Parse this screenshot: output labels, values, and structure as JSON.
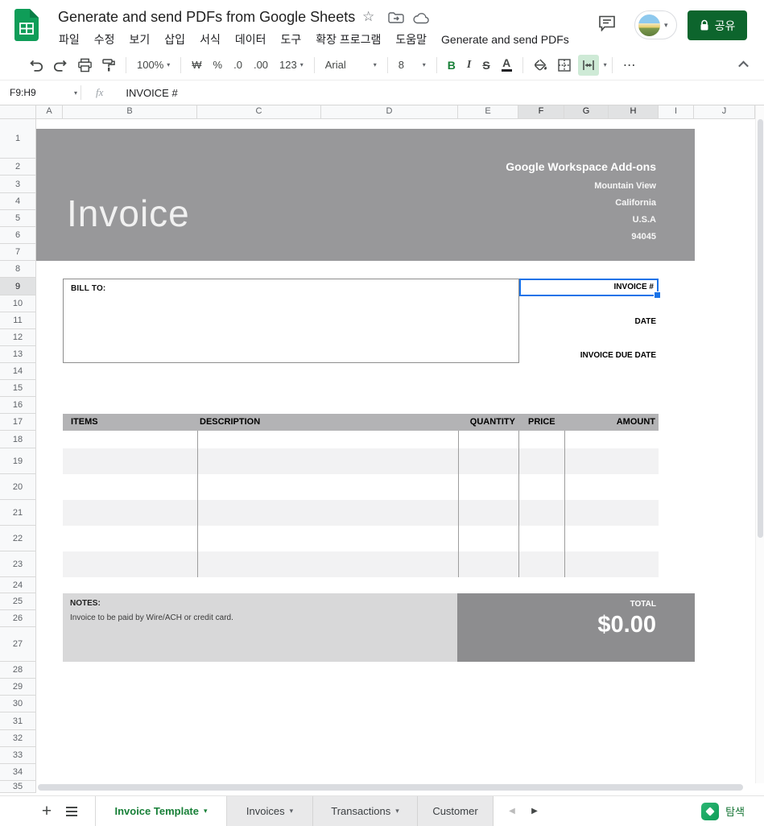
{
  "app": {
    "product": "Google Sheets",
    "doc_title": "Generate and send PDFs from Google Sheets",
    "menus": [
      "파일",
      "수정",
      "보기",
      "삽입",
      "서식",
      "데이터",
      "도구",
      "확장 프로그램",
      "도움말",
      "Generate and send PDFs"
    ],
    "share_label": "공유",
    "explore_label": "탐색"
  },
  "toolbar": {
    "zoom": "100%",
    "currency": "₩",
    "percent": "%",
    "decimal_decrease": ".0",
    "decimal_increase": ".00",
    "number_format": "123",
    "font_name": "Arial",
    "font_size": "8",
    "bold": "B",
    "italic": "I",
    "strikethrough": "S",
    "text_color": "A"
  },
  "formula_bar": {
    "cell_ref": "F9:H9",
    "fx_label": "fx",
    "value": "INVOICE #"
  },
  "grid": {
    "columns": [
      "A",
      "B",
      "C",
      "D",
      "E",
      "F",
      "G",
      "H",
      "I",
      "J"
    ],
    "rows": [
      "1",
      "2",
      "3",
      "4",
      "5",
      "6",
      "7",
      "8",
      "9",
      "10",
      "11",
      "12",
      "13",
      "14",
      "15",
      "16",
      "17",
      "18",
      "19",
      "20",
      "21",
      "22",
      "23",
      "24",
      "25",
      "26",
      "27",
      "28",
      "29",
      "30",
      "31",
      "32",
      "33",
      "34",
      "35"
    ],
    "selection": {
      "range": "F9:H9",
      "columns": [
        "F",
        "G",
        "H"
      ],
      "rows": [
        "9"
      ]
    }
  },
  "invoice": {
    "title": "Invoice",
    "company_name": "Google Workspace Add-ons",
    "address_lines": [
      "Mountain View",
      "California",
      "U.S.A",
      "94045"
    ],
    "bill_to_label": "BILL TO:",
    "invoice_number_label": "INVOICE #",
    "date_label": "DATE",
    "due_date_label": "INVOICE DUE DATE",
    "table_headers": [
      "ITEMS",
      "DESCRIPTION",
      "QUANTITY",
      "PRICE",
      "AMOUNT"
    ],
    "notes_label": "NOTES:",
    "notes_text": "Invoice to be paid by Wire/ACH or credit card.",
    "total_label": "TOTAL",
    "total_value": "$0.00"
  },
  "sheets_bar": {
    "tabs": [
      {
        "label": "Invoice Template",
        "active": true,
        "truncated": false
      },
      {
        "label": "Invoices",
        "active": false,
        "truncated": false
      },
      {
        "label": "Transactions",
        "active": false,
        "truncated": false
      },
      {
        "label": "Customer",
        "active": false,
        "truncated": true
      }
    ]
  },
  "icons": {
    "caret_down": "▾",
    "plus": "+",
    "star": "☆",
    "more_horizontal": "⋯",
    "nav_left": "◀",
    "nav_right": "▶"
  },
  "colors": {
    "brand_green": "#0f9d58",
    "share_button_green": "#0d652d",
    "active_tab_green": "#188038",
    "bold_active_green": "#188038",
    "merge_active_bg": "#ceead6",
    "selection_blue": "#1a73e8",
    "invoice_header_gray": "#98989a",
    "items_header_gray": "#b3b3b5",
    "stripe_gray": "#f2f2f3",
    "notes_gray": "#d8d8d9",
    "total_gray": "#8d8d8f"
  }
}
